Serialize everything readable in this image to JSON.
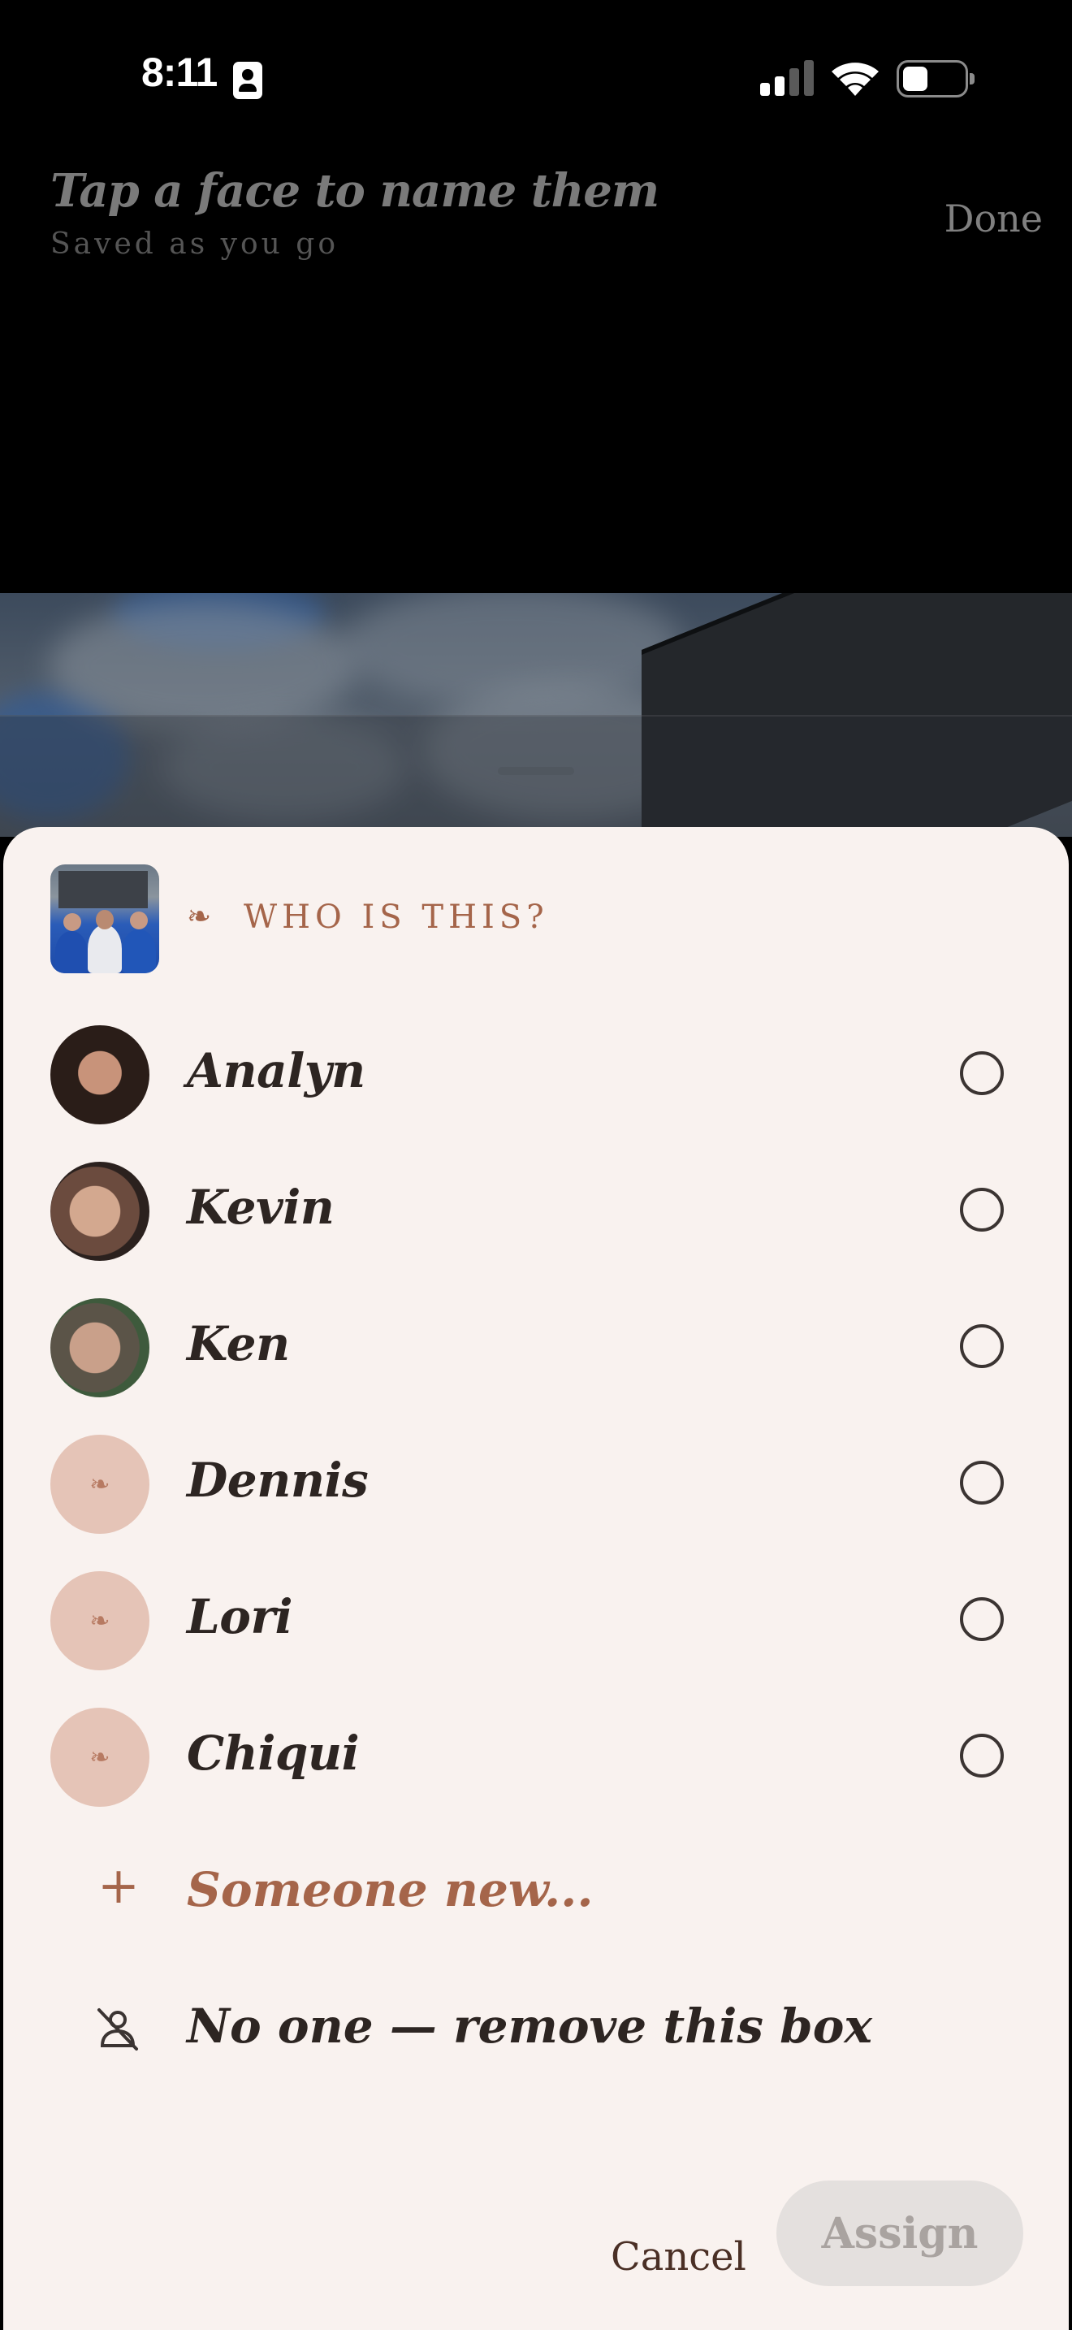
{
  "status_bar": {
    "time": "8:11"
  },
  "header": {
    "title": "Tap a face to name them",
    "subtitle": "Saved as you go",
    "done_label": "Done"
  },
  "sheet": {
    "heading_icon": "❧",
    "heading": "WHO IS THIS?",
    "people": [
      {
        "name": "Analyn",
        "has_photo": true
      },
      {
        "name": "Kevin",
        "has_photo": true
      },
      {
        "name": "Ken",
        "has_photo": true
      },
      {
        "name": "Dennis",
        "has_photo": false,
        "placeholder_glyph": "❧"
      },
      {
        "name": "Lori",
        "has_photo": false,
        "placeholder_glyph": "❧"
      },
      {
        "name": "Chiqui",
        "has_photo": false,
        "placeholder_glyph": "❧"
      }
    ],
    "new_person": {
      "icon": "+",
      "label": "Someone new..."
    },
    "no_one": {
      "icon": "person-slash-icon",
      "label": "No one — remove this box"
    },
    "cancel_label": "Cancel",
    "assign_label": "Assign"
  },
  "colors": {
    "accent": "#a5654a",
    "sheet_bg": "#f9f2ef",
    "placeholder_avatar": "#e5c4b7",
    "text_dark": "#2d2522",
    "assign_disabled_bg": "#e4e0de"
  }
}
